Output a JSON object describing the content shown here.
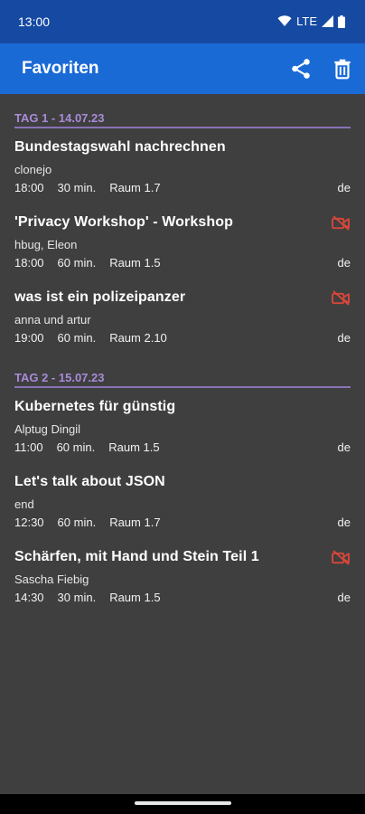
{
  "status_bar": {
    "time": "13:00",
    "network": "LTE"
  },
  "app_bar": {
    "title": "Favoriten",
    "share_icon": "share-icon",
    "delete_icon": "trash-icon"
  },
  "colors": {
    "status_bar": "#164aa2",
    "app_bar": "#1a6ad6",
    "background": "#3f3f3f",
    "day_header": "#a98bd9",
    "no_video": "#d6473a"
  },
  "days": [
    {
      "label": "TAG 1 - 14.07.23",
      "sessions": [
        {
          "title": "Bundestagswahl nachrechnen",
          "speakers": "clonejo",
          "time": "18:00",
          "duration": "30 min.",
          "room": "Raum 1.7",
          "lang": "de",
          "no_video": false
        },
        {
          "title": "'Privacy Workshop' - Workshop",
          "speakers": "hbug, Eleon",
          "time": "18:00",
          "duration": "60 min.",
          "room": "Raum 1.5",
          "lang": "de",
          "no_video": true
        },
        {
          "title": "was ist ein polizeipanzer",
          "speakers": "anna und artur",
          "time": "19:00",
          "duration": "60 min.",
          "room": "Raum 2.10",
          "lang": "de",
          "no_video": true
        }
      ]
    },
    {
      "label": "TAG 2 - 15.07.23",
      "sessions": [
        {
          "title": "Kubernetes für günstig",
          "speakers": "Alptug Dingil",
          "time": "11:00",
          "duration": "60 min.",
          "room": "Raum 1.5",
          "lang": "de",
          "no_video": false
        },
        {
          "title": "Let's talk about JSON",
          "speakers": "end",
          "time": "12:30",
          "duration": "60 min.",
          "room": "Raum 1.7",
          "lang": "de",
          "no_video": false
        },
        {
          "title": "Schärfen, mit Hand und Stein Teil 1",
          "speakers": "Sascha Fiebig",
          "time": "14:30",
          "duration": "30 min.",
          "room": "Raum 1.5",
          "lang": "de",
          "no_video": true
        }
      ]
    }
  ]
}
